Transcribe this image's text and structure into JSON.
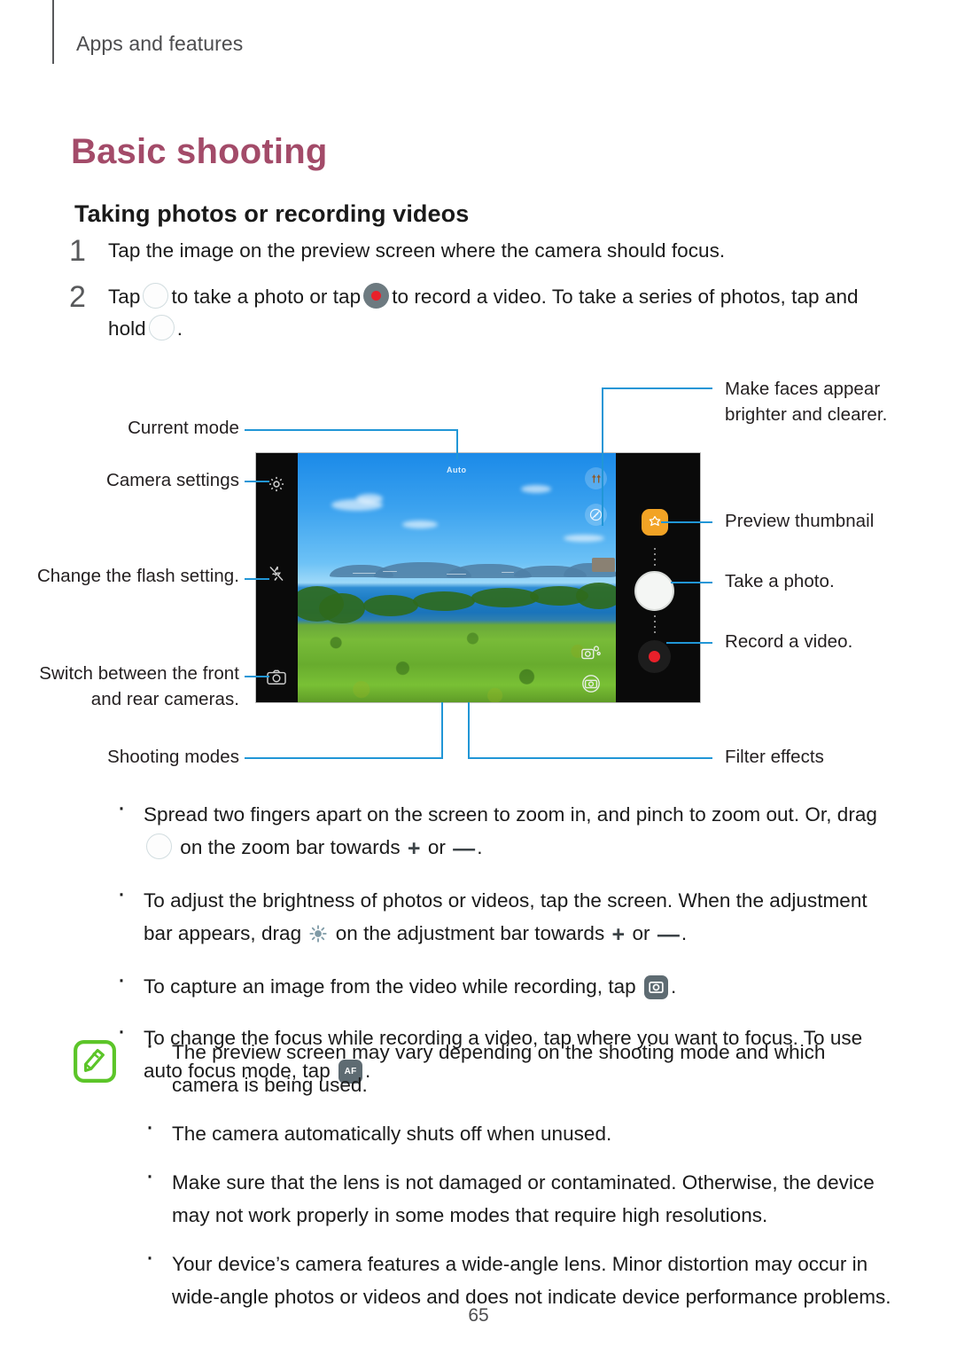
{
  "breadcrumb": "Apps and features",
  "page_title": "Basic shooting",
  "section_title": "Taking photos or recording videos",
  "page_number": "65",
  "accent_color": "#a34b69",
  "leader_color": "#2196d6",
  "note_icon_color": "#5cc529",
  "steps": [
    {
      "number": "1",
      "text": "Tap the image on the preview screen where the camera should focus."
    },
    {
      "number": "2",
      "text_part1": "Tap",
      "text_part2": "to take a photo or tap",
      "text_part3": "to record a video. To take a series of photos, tap and hold",
      "text_part4": "."
    }
  ],
  "diagram": {
    "mode_label": "Auto",
    "labels": {
      "current_mode": "Current mode",
      "camera_settings": "Camera settings",
      "change_flash": "Change the flash setting.",
      "switch_cameras": "Switch between the front and rear cameras.",
      "shooting_modes": "Shooting modes",
      "make_faces": "Make faces appear brighter and clearer.",
      "preview_thumbnail": "Preview thumbnail",
      "take_photo": "Take a photo.",
      "record_video": "Record a video.",
      "filter_effects": "Filter effects"
    },
    "icons": {
      "settings": "gear-icon",
      "flash": "flash-off-icon",
      "switch": "camera-switch-icon",
      "beauty": "face-beauty-icon",
      "filter": "filter-effects-icon",
      "bokeh": "bokeh-shot-icon",
      "capture_frame": "capture-frame-icon",
      "thumbnail": "preview-thumbnail-icon",
      "shutter": "shutter-button",
      "record": "record-button"
    }
  },
  "bullets": [
    {
      "part1": "Spread two fingers apart on the screen to zoom in, and pinch to zoom out. Or, drag",
      "part2": "on the zoom bar towards",
      "part3": "or",
      "part4": "."
    },
    {
      "part1": "To adjust the brightness of photos or videos, tap the screen. When the adjustment bar appears, drag",
      "part2": "on the adjustment bar towards",
      "part3": "or",
      "part4": "."
    },
    {
      "part1": "To capture an image from the video while recording, tap",
      "part2": "."
    },
    {
      "part1": "To change the focus while recording a video, tap where you want to focus. To use auto focus mode, tap",
      "part2": "."
    }
  ],
  "note_bullets": [
    "The preview screen may vary depending on the shooting mode and which camera is being used.",
    "The camera automatically shuts off when unused.",
    "Make sure that the lens is not damaged or contaminated. Otherwise, the device may not work properly in some modes that require high resolutions.",
    "Your device’s camera features a wide-angle lens. Minor distortion may occur in wide-angle photos or videos and does not indicate device performance problems."
  ],
  "symbols": {
    "plus": "+",
    "minus": "—",
    "af": "AF"
  }
}
